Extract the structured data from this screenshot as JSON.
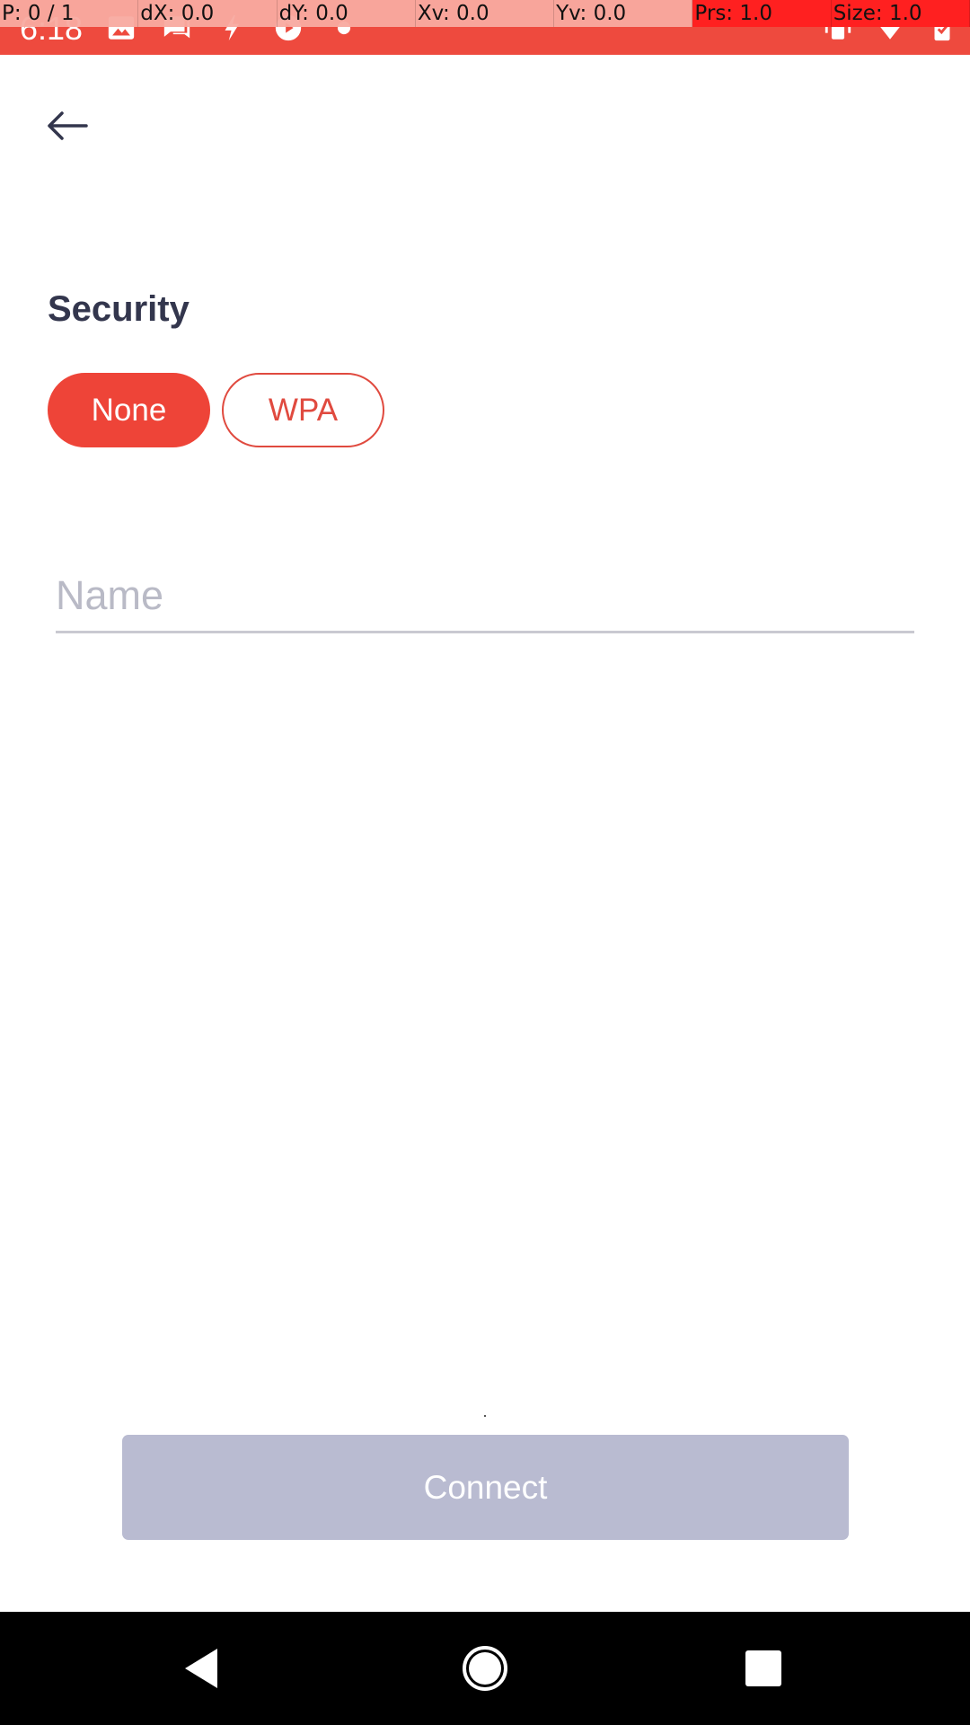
{
  "status_bar": {
    "time": "6:18",
    "background": "#ee4a3e",
    "left_icons": [
      "image-icon",
      "chat-icon",
      "flash-icon",
      "sync-icon",
      "dot-icon"
    ],
    "right_icons": [
      "vibrate-icon",
      "wifi-icon",
      "battery-icon"
    ]
  },
  "debug_overlay": {
    "pointer": "P: 0 / 1",
    "dx": "dX: 0.0",
    "dy": "dY: 0.0",
    "xv": "Xv: 0.0",
    "yv": "Yv: 0.0",
    "prs": "Prs: 1.0",
    "size": "Size: 1.0"
  },
  "header": {
    "back_icon": "arrow-left-icon"
  },
  "security": {
    "title": "Security",
    "options": [
      {
        "label": "None",
        "selected": true
      },
      {
        "label": "WPA",
        "selected": false
      }
    ]
  },
  "name_field": {
    "placeholder": "Name",
    "value": ""
  },
  "connect": {
    "label": "Connect",
    "enabled": false
  },
  "nav_bar": {
    "back_icon": "triangle-back-icon",
    "home_icon": "circle-home-icon",
    "recents_icon": "square-recents-icon"
  },
  "colors": {
    "accent": "#ee4438",
    "title_text": "#33364d",
    "placeholder": "#b9bac6",
    "connect_disabled": "#b9bbd1"
  }
}
